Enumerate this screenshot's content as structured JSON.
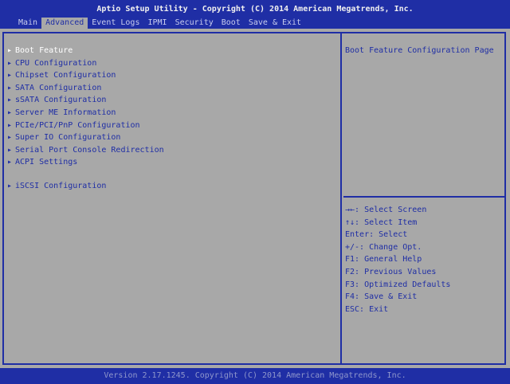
{
  "header": {
    "title": "Aptio Setup Utility - Copyright (C) 2014 American Megatrends, Inc.",
    "tabs": [
      "Main",
      "Advanced",
      "Event Logs",
      "IPMI",
      "Security",
      "Boot",
      "Save & Exit"
    ],
    "active_tab": "Advanced"
  },
  "menu": {
    "items": [
      "Boot Feature",
      "CPU Configuration",
      "Chipset Configuration",
      "SATA Configuration",
      "sSATA Configuration",
      "Server ME Information",
      "PCIe/PCI/PnP Configuration",
      "Super IO Configuration",
      "Serial Port Console Redirection",
      "ACPI Settings",
      "iSCSI Configuration"
    ],
    "selected": "Boot Feature"
  },
  "help": {
    "text": "Boot Feature Configuration Page"
  },
  "keys": [
    "→←: Select Screen",
    "↑↓: Select Item",
    "Enter: Select",
    "+/-: Change Opt.",
    "F1: General Help",
    "F2: Previous Values",
    "F3: Optimized Defaults",
    "F4: Save & Exit",
    "ESC: Exit"
  ],
  "footer": {
    "version": "Version 2.17.1245. Copyright (C) 2014 American Megatrends, Inc."
  },
  "colors": {
    "primary_blue": "#1f2ea5",
    "panel_gray": "#a8a8a8",
    "highlight": "#ffffff"
  }
}
